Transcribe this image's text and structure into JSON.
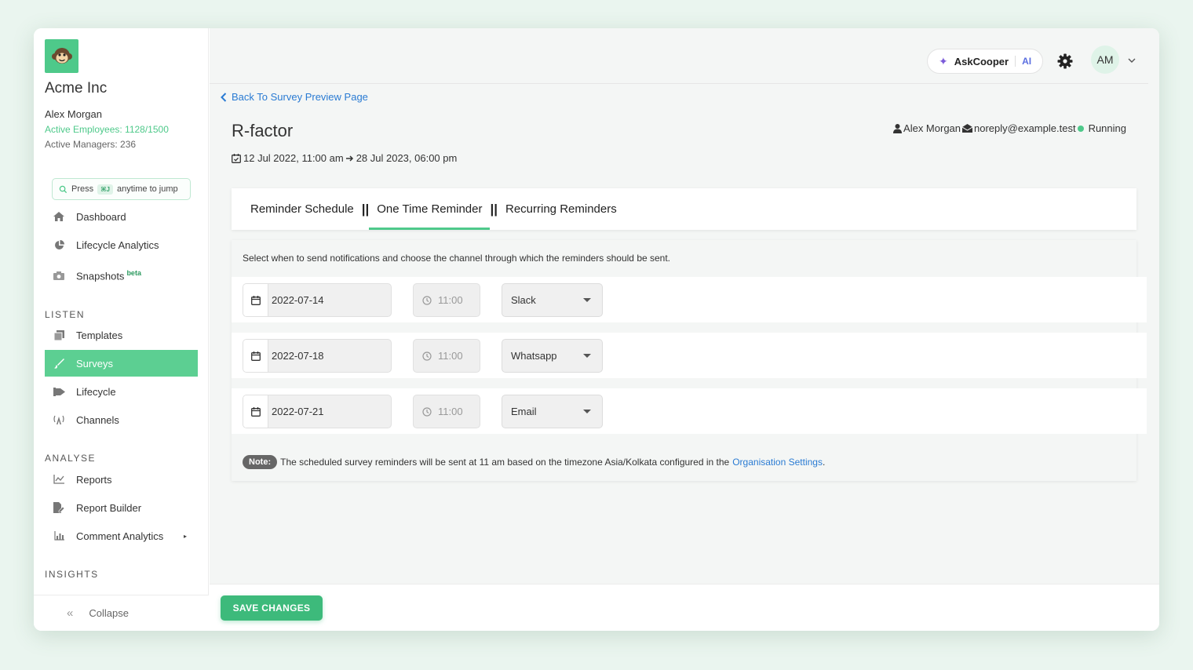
{
  "sidebar": {
    "org_name": "Acme Inc",
    "user_name": "Alex Morgan",
    "active_employees": "Active Employees: 1128/1500",
    "active_managers": "Active Managers: 236",
    "jump": {
      "press": "Press",
      "shortcut": "⌘J",
      "anytime": "anytime to jump"
    },
    "items_top": [
      {
        "label": "Dashboard",
        "icon": "home-icon"
      },
      {
        "label": "Lifecycle Analytics",
        "icon": "pie-chart-icon"
      },
      {
        "label": "Snapshots",
        "icon": "camera-icon",
        "badge": "beta"
      }
    ],
    "section_listen": "LISTEN",
    "items_listen": [
      {
        "label": "Templates",
        "icon": "copy-icon"
      },
      {
        "label": "Surveys",
        "icon": "brush-icon",
        "active": true
      },
      {
        "label": "Lifecycle",
        "icon": "flag-icon"
      },
      {
        "label": "Channels",
        "icon": "broadcast-icon"
      }
    ],
    "section_analyse": "ANALYSE",
    "items_analyse": [
      {
        "label": "Reports",
        "icon": "line-chart-icon"
      },
      {
        "label": "Report Builder",
        "icon": "file-edit-icon"
      },
      {
        "label": "Comment Analytics",
        "icon": "bar-chart-icon",
        "arrow": "▸"
      }
    ],
    "section_insights": "INSIGHTS",
    "collapse_label": "Collapse",
    "collapse_icon": "«"
  },
  "topbar": {
    "ask_label": "AskCooper",
    "ask_ai": "AI",
    "avatar_initials": "AM"
  },
  "main": {
    "back_label": "Back To Survey Preview Page",
    "title": "R-factor",
    "meta": {
      "owner": "Alex Morgan",
      "email": "noreply@example.test",
      "status": "Running"
    },
    "dates": {
      "start": "12 Jul 2022, 11:00 am",
      "end": "28 Jul 2023, 06:00 pm"
    },
    "tabs": [
      {
        "label": "Reminder Schedule"
      },
      {
        "label": "One Time Reminder",
        "active": true
      },
      {
        "label": "Recurring Reminders"
      }
    ],
    "instruction": "Select when to send notifications and choose the channel through which the reminders should be sent.",
    "reminders": [
      {
        "date": "2022-07-14",
        "time": "11:00",
        "channel": "Slack"
      },
      {
        "date": "2022-07-18",
        "time": "11:00",
        "channel": "Whatsapp"
      },
      {
        "date": "2022-07-21",
        "time": "11:00",
        "channel": "Email"
      }
    ],
    "note": {
      "badge": "Note:",
      "text": "The scheduled survey reminders will be sent at 11 am based on the timezone Asia/Kolkata configured in the",
      "link": "Organisation Settings",
      "suffix": "."
    },
    "save_label": "SAVE CHANGES"
  },
  "colors": {
    "accent": "#4ec98a",
    "link": "#2a7bd3",
    "save": "#3dba7b"
  }
}
